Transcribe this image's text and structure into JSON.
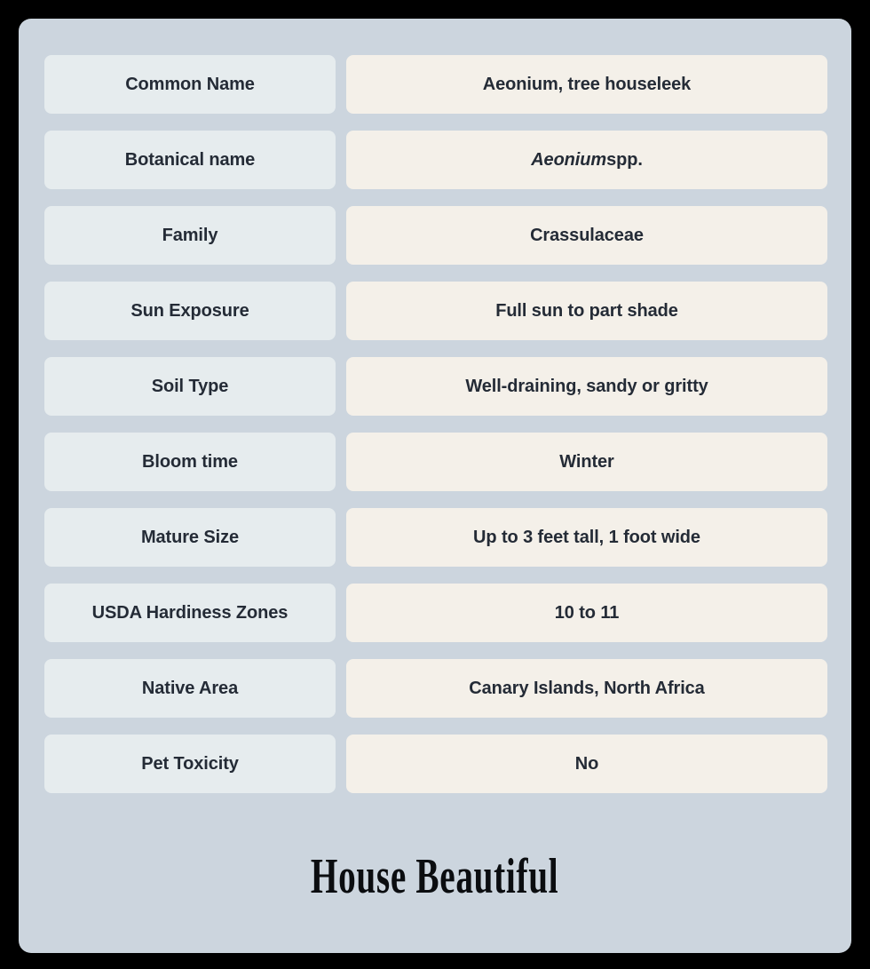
{
  "card": {
    "background_color": "#ccd5de",
    "label_cell_color": "#e6ecee",
    "value_cell_color": "#f4f0e9",
    "text_color": "#242b36"
  },
  "spec_table": {
    "rows": [
      {
        "label": "Common Name",
        "value": "Aeonium, tree houseleek",
        "value_italic_prefix": "",
        "value_rest": "Aeonium, tree houseleek"
      },
      {
        "label": "Botanical name",
        "value": "Aeonium spp.",
        "value_italic_prefix": "Aeonium",
        "value_rest": " spp."
      },
      {
        "label": "Family",
        "value": "Crassulaceae",
        "value_italic_prefix": "",
        "value_rest": "Crassulaceae"
      },
      {
        "label": "Sun Exposure",
        "value": "Full sun to part shade",
        "value_italic_prefix": "",
        "value_rest": "Full sun to part shade"
      },
      {
        "label": "Soil Type",
        "value": "Well-draining, sandy or gritty",
        "value_italic_prefix": "",
        "value_rest": "Well-draining, sandy or gritty"
      },
      {
        "label": "Bloom time",
        "value": "Winter",
        "value_italic_prefix": "",
        "value_rest": "Winter"
      },
      {
        "label": "Mature Size",
        "value": "Up to 3 feet tall, 1 foot wide",
        "value_italic_prefix": "",
        "value_rest": "Up to 3 feet tall, 1 foot wide"
      },
      {
        "label": "USDA Hardiness Zones",
        "value": "10 to 11",
        "value_italic_prefix": "",
        "value_rest": "10 to 11"
      },
      {
        "label": "Native Area",
        "value": "Canary Islands, North Africa",
        "value_italic_prefix": "",
        "value_rest": "Canary Islands, North Africa"
      },
      {
        "label": "Pet Toxicity",
        "value": "No",
        "value_italic_prefix": "",
        "value_rest": "No"
      }
    ]
  },
  "brand": {
    "wordmark": "House Beautiful"
  }
}
